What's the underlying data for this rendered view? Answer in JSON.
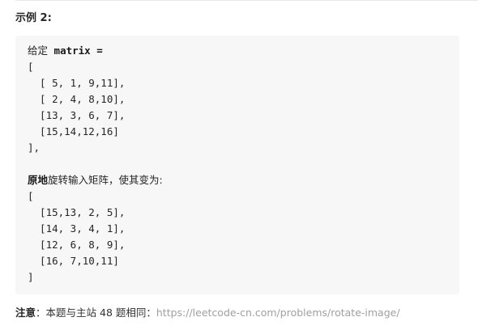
{
  "heading": "示例 2:",
  "code": {
    "intro_label": "给定",
    "intro_code": " matrix =",
    "matrix_open": "[",
    "input_rows": [
      "  [ 5, 1, 9,11],",
      "  [ 2, 4, 8,10],",
      "  [13, 3, 6, 7],",
      "  [15,14,12,16]"
    ],
    "matrix_close_comma": "],",
    "instruction_bold": "原地",
    "instruction_rest": "旋转输入矩阵，使其变为:",
    "output_rows": [
      "  [15,13, 2, 5],",
      "  [14, 3, 4, 1],",
      "  [12, 6, 8, 9],",
      "  [16, 7,10,11]"
    ],
    "matrix_close": "]"
  },
  "footer": {
    "note_bold": "注意",
    "note_text": "：本题与主站 48 题相同：",
    "link": "https://leetcode-cn.com/problems/rotate-image/"
  },
  "colors": {
    "code_background": "#f7f7f7",
    "link": "#a0a0a0",
    "text": "#333333"
  }
}
